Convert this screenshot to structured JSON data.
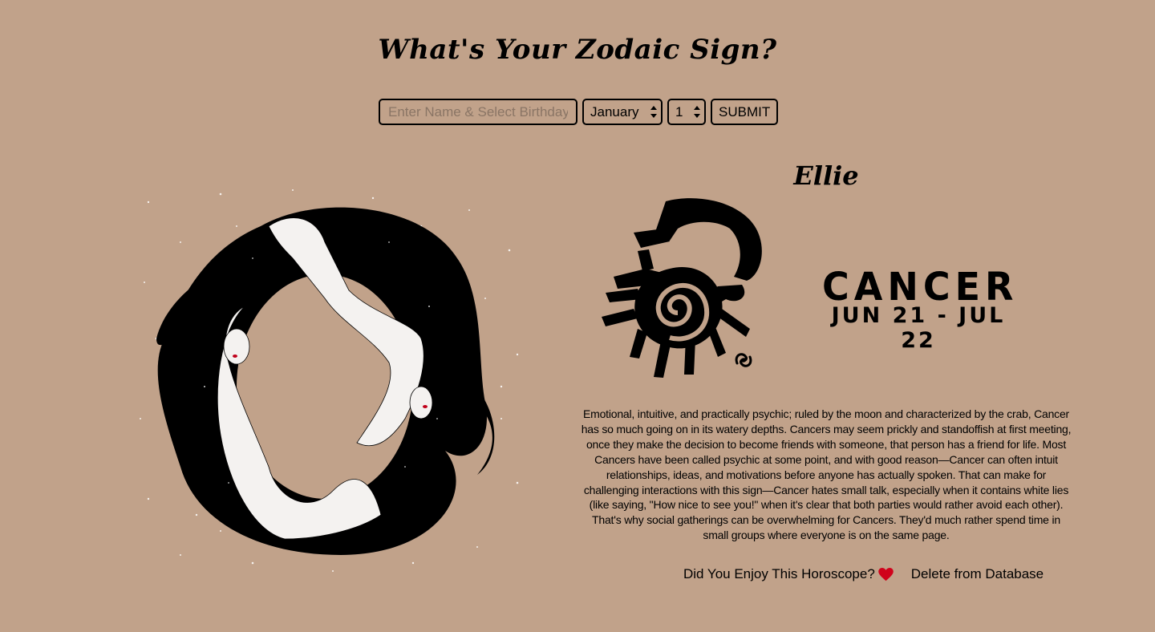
{
  "page_title": "What's Your Zodaic Sign?",
  "form": {
    "name_placeholder": "Enter Name & Select Birthday",
    "month_value": "January",
    "day_value": "1",
    "submit_label": "SUBMIT"
  },
  "result": {
    "user_name": "Ellie",
    "sign": "CANCER",
    "dates": "JUN 21 - JUL 22",
    "description": "Emotional, intuitive, and practically psychic; ruled by the moon and characterized by the crab, Cancer has so much going on in its watery depths. Cancers may seem prickly and standoffish at first meeting, once they make the decision to become friends with someone, that person has a friend for life. Most Cancers have been called psychic at some point, and with good reason—Cancer can often intuit relationships, ideas, and motivations before anyone has actually spoken. That can make for challenging interactions with this sign—Cancer hates small talk, especially when it contains white lies (like saying, \"How nice to see you!\" when it's clear that both parties would rather avoid each other). That's why social gatherings can be overwhelming for Cancers. They'd much rather spend time in small groups where everyone is on the same page."
  },
  "actions": {
    "enjoy_label": "Did You Enjoy This Horoscope?",
    "delete_label": "Delete from Database"
  },
  "icons": {
    "heart": "heart-icon",
    "crab": "cancer-crab-icon",
    "cancer_glyph": "cancer-symbol-icon"
  },
  "colors": {
    "background": "#c1a28a",
    "heart": "#d0021b"
  }
}
